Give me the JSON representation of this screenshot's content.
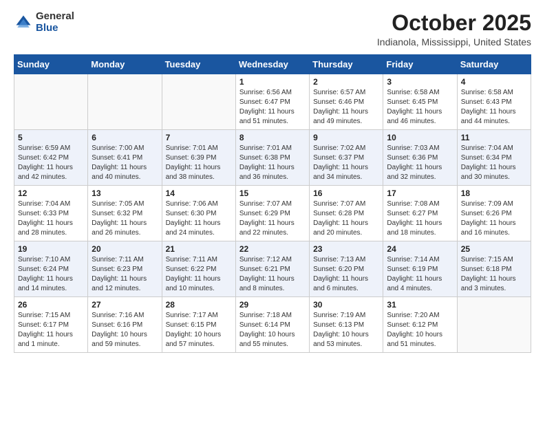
{
  "header": {
    "logo_general": "General",
    "logo_blue": "Blue",
    "month_title": "October 2025",
    "location": "Indianola, Mississippi, United States"
  },
  "weekdays": [
    "Sunday",
    "Monday",
    "Tuesday",
    "Wednesday",
    "Thursday",
    "Friday",
    "Saturday"
  ],
  "weeks": [
    [
      {
        "day": "",
        "info": ""
      },
      {
        "day": "",
        "info": ""
      },
      {
        "day": "",
        "info": ""
      },
      {
        "day": "1",
        "info": "Sunrise: 6:56 AM\nSunset: 6:47 PM\nDaylight: 11 hours\nand 51 minutes."
      },
      {
        "day": "2",
        "info": "Sunrise: 6:57 AM\nSunset: 6:46 PM\nDaylight: 11 hours\nand 49 minutes."
      },
      {
        "day": "3",
        "info": "Sunrise: 6:58 AM\nSunset: 6:45 PM\nDaylight: 11 hours\nand 46 minutes."
      },
      {
        "day": "4",
        "info": "Sunrise: 6:58 AM\nSunset: 6:43 PM\nDaylight: 11 hours\nand 44 minutes."
      }
    ],
    [
      {
        "day": "5",
        "info": "Sunrise: 6:59 AM\nSunset: 6:42 PM\nDaylight: 11 hours\nand 42 minutes."
      },
      {
        "day": "6",
        "info": "Sunrise: 7:00 AM\nSunset: 6:41 PM\nDaylight: 11 hours\nand 40 minutes."
      },
      {
        "day": "7",
        "info": "Sunrise: 7:01 AM\nSunset: 6:39 PM\nDaylight: 11 hours\nand 38 minutes."
      },
      {
        "day": "8",
        "info": "Sunrise: 7:01 AM\nSunset: 6:38 PM\nDaylight: 11 hours\nand 36 minutes."
      },
      {
        "day": "9",
        "info": "Sunrise: 7:02 AM\nSunset: 6:37 PM\nDaylight: 11 hours\nand 34 minutes."
      },
      {
        "day": "10",
        "info": "Sunrise: 7:03 AM\nSunset: 6:36 PM\nDaylight: 11 hours\nand 32 minutes."
      },
      {
        "day": "11",
        "info": "Sunrise: 7:04 AM\nSunset: 6:34 PM\nDaylight: 11 hours\nand 30 minutes."
      }
    ],
    [
      {
        "day": "12",
        "info": "Sunrise: 7:04 AM\nSunset: 6:33 PM\nDaylight: 11 hours\nand 28 minutes."
      },
      {
        "day": "13",
        "info": "Sunrise: 7:05 AM\nSunset: 6:32 PM\nDaylight: 11 hours\nand 26 minutes."
      },
      {
        "day": "14",
        "info": "Sunrise: 7:06 AM\nSunset: 6:30 PM\nDaylight: 11 hours\nand 24 minutes."
      },
      {
        "day": "15",
        "info": "Sunrise: 7:07 AM\nSunset: 6:29 PM\nDaylight: 11 hours\nand 22 minutes."
      },
      {
        "day": "16",
        "info": "Sunrise: 7:07 AM\nSunset: 6:28 PM\nDaylight: 11 hours\nand 20 minutes."
      },
      {
        "day": "17",
        "info": "Sunrise: 7:08 AM\nSunset: 6:27 PM\nDaylight: 11 hours\nand 18 minutes."
      },
      {
        "day": "18",
        "info": "Sunrise: 7:09 AM\nSunset: 6:26 PM\nDaylight: 11 hours\nand 16 minutes."
      }
    ],
    [
      {
        "day": "19",
        "info": "Sunrise: 7:10 AM\nSunset: 6:24 PM\nDaylight: 11 hours\nand 14 minutes."
      },
      {
        "day": "20",
        "info": "Sunrise: 7:11 AM\nSunset: 6:23 PM\nDaylight: 11 hours\nand 12 minutes."
      },
      {
        "day": "21",
        "info": "Sunrise: 7:11 AM\nSunset: 6:22 PM\nDaylight: 11 hours\nand 10 minutes."
      },
      {
        "day": "22",
        "info": "Sunrise: 7:12 AM\nSunset: 6:21 PM\nDaylight: 11 hours\nand 8 minutes."
      },
      {
        "day": "23",
        "info": "Sunrise: 7:13 AM\nSunset: 6:20 PM\nDaylight: 11 hours\nand 6 minutes."
      },
      {
        "day": "24",
        "info": "Sunrise: 7:14 AM\nSunset: 6:19 PM\nDaylight: 11 hours\nand 4 minutes."
      },
      {
        "day": "25",
        "info": "Sunrise: 7:15 AM\nSunset: 6:18 PM\nDaylight: 11 hours\nand 3 minutes."
      }
    ],
    [
      {
        "day": "26",
        "info": "Sunrise: 7:15 AM\nSunset: 6:17 PM\nDaylight: 11 hours\nand 1 minute."
      },
      {
        "day": "27",
        "info": "Sunrise: 7:16 AM\nSunset: 6:16 PM\nDaylight: 10 hours\nand 59 minutes."
      },
      {
        "day": "28",
        "info": "Sunrise: 7:17 AM\nSunset: 6:15 PM\nDaylight: 10 hours\nand 57 minutes."
      },
      {
        "day": "29",
        "info": "Sunrise: 7:18 AM\nSunset: 6:14 PM\nDaylight: 10 hours\nand 55 minutes."
      },
      {
        "day": "30",
        "info": "Sunrise: 7:19 AM\nSunset: 6:13 PM\nDaylight: 10 hours\nand 53 minutes."
      },
      {
        "day": "31",
        "info": "Sunrise: 7:20 AM\nSunset: 6:12 PM\nDaylight: 10 hours\nand 51 minutes."
      },
      {
        "day": "",
        "info": ""
      }
    ]
  ]
}
